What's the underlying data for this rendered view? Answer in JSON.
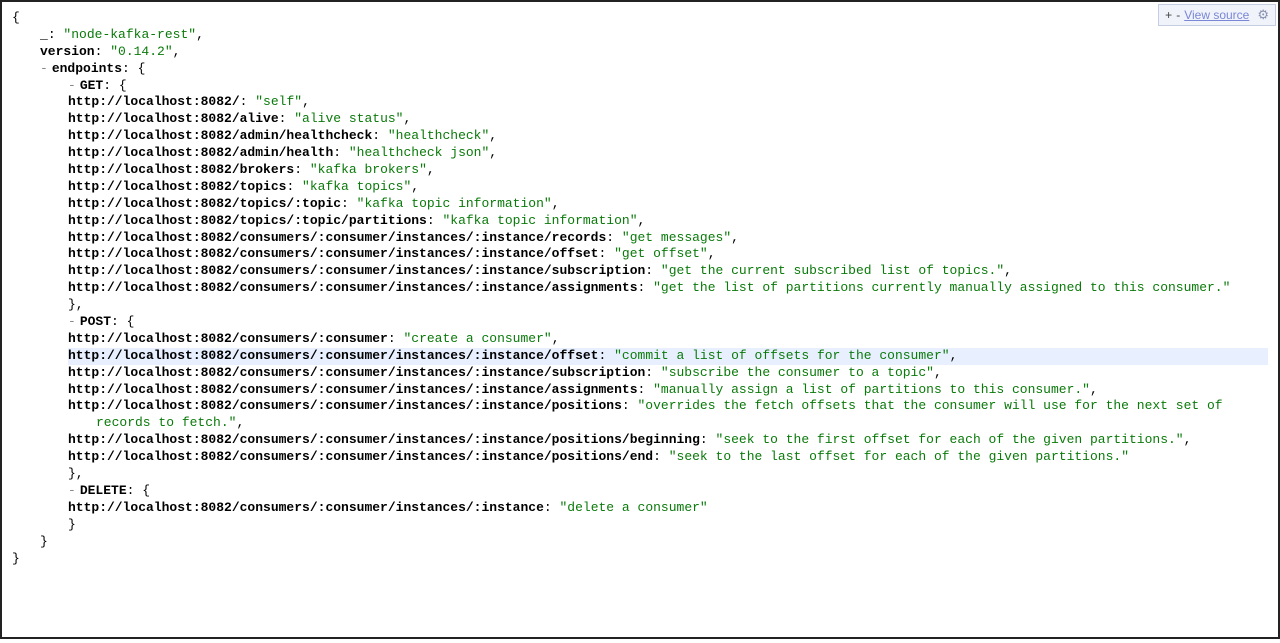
{
  "toolbar": {
    "plus": "+",
    "minus": "-",
    "view_source": "View source",
    "gear": "⚙"
  },
  "root": {
    "name_key": "_",
    "name_val": "node-kafka-rest",
    "version_key": "version",
    "version_val": "0.14.2",
    "endpoints_key": "endpoints",
    "GET": {
      "label": "GET",
      "items": [
        {
          "k": "http://localhost:8082/",
          "v": "self"
        },
        {
          "k": "http://localhost:8082/alive",
          "v": "alive status"
        },
        {
          "k": "http://localhost:8082/admin/healthcheck",
          "v": "healthcheck"
        },
        {
          "k": "http://localhost:8082/admin/health",
          "v": "healthcheck json"
        },
        {
          "k": "http://localhost:8082/brokers",
          "v": "kafka brokers"
        },
        {
          "k": "http://localhost:8082/topics",
          "v": "kafka topics"
        },
        {
          "k": "http://localhost:8082/topics/:topic",
          "v": "kafka topic information"
        },
        {
          "k": "http://localhost:8082/topics/:topic/partitions",
          "v": "kafka topic information"
        },
        {
          "k": "http://localhost:8082/consumers/:consumer/instances/:instance/records",
          "v": "get messages"
        },
        {
          "k": "http://localhost:8082/consumers/:consumer/instances/:instance/offset",
          "v": "get offset"
        },
        {
          "k": "http://localhost:8082/consumers/:consumer/instances/:instance/subscription",
          "v": "get the current subscribed list of topics."
        },
        {
          "k": "http://localhost:8082/consumers/:consumer/instances/:instance/assignments",
          "v": "get the list of partitions currently manually assigned to this consumer."
        }
      ]
    },
    "POST": {
      "label": "POST",
      "items": [
        {
          "k": "http://localhost:8082/consumers/:consumer",
          "v": "create a consumer"
        },
        {
          "k": "http://localhost:8082/consumers/:consumer/instances/:instance/offset",
          "v": "commit a list of offsets for the consumer",
          "hl": true
        },
        {
          "k": "http://localhost:8082/consumers/:consumer/instances/:instance/subscription",
          "v": "subscribe the consumer to a topic"
        },
        {
          "k": "http://localhost:8082/consumers/:consumer/instances/:instance/assignments",
          "v": "manually assign a list of partitions to this consumer."
        },
        {
          "k": "http://localhost:8082/consumers/:consumer/instances/:instance/positions",
          "v": "overrides the fetch offsets that the consumer will use for the next set of records to fetch."
        },
        {
          "k": "http://localhost:8082/consumers/:consumer/instances/:instance/positions/beginning",
          "v": "seek to the first offset for each of the given partitions."
        },
        {
          "k": "http://localhost:8082/consumers/:consumer/instances/:instance/positions/end",
          "v": "seek to the last offset for each of the given partitions."
        }
      ]
    },
    "DELETE": {
      "label": "DELETE",
      "items": [
        {
          "k": "http://localhost:8082/consumers/:consumer/instances/:instance",
          "v": "delete a consumer"
        }
      ]
    }
  }
}
